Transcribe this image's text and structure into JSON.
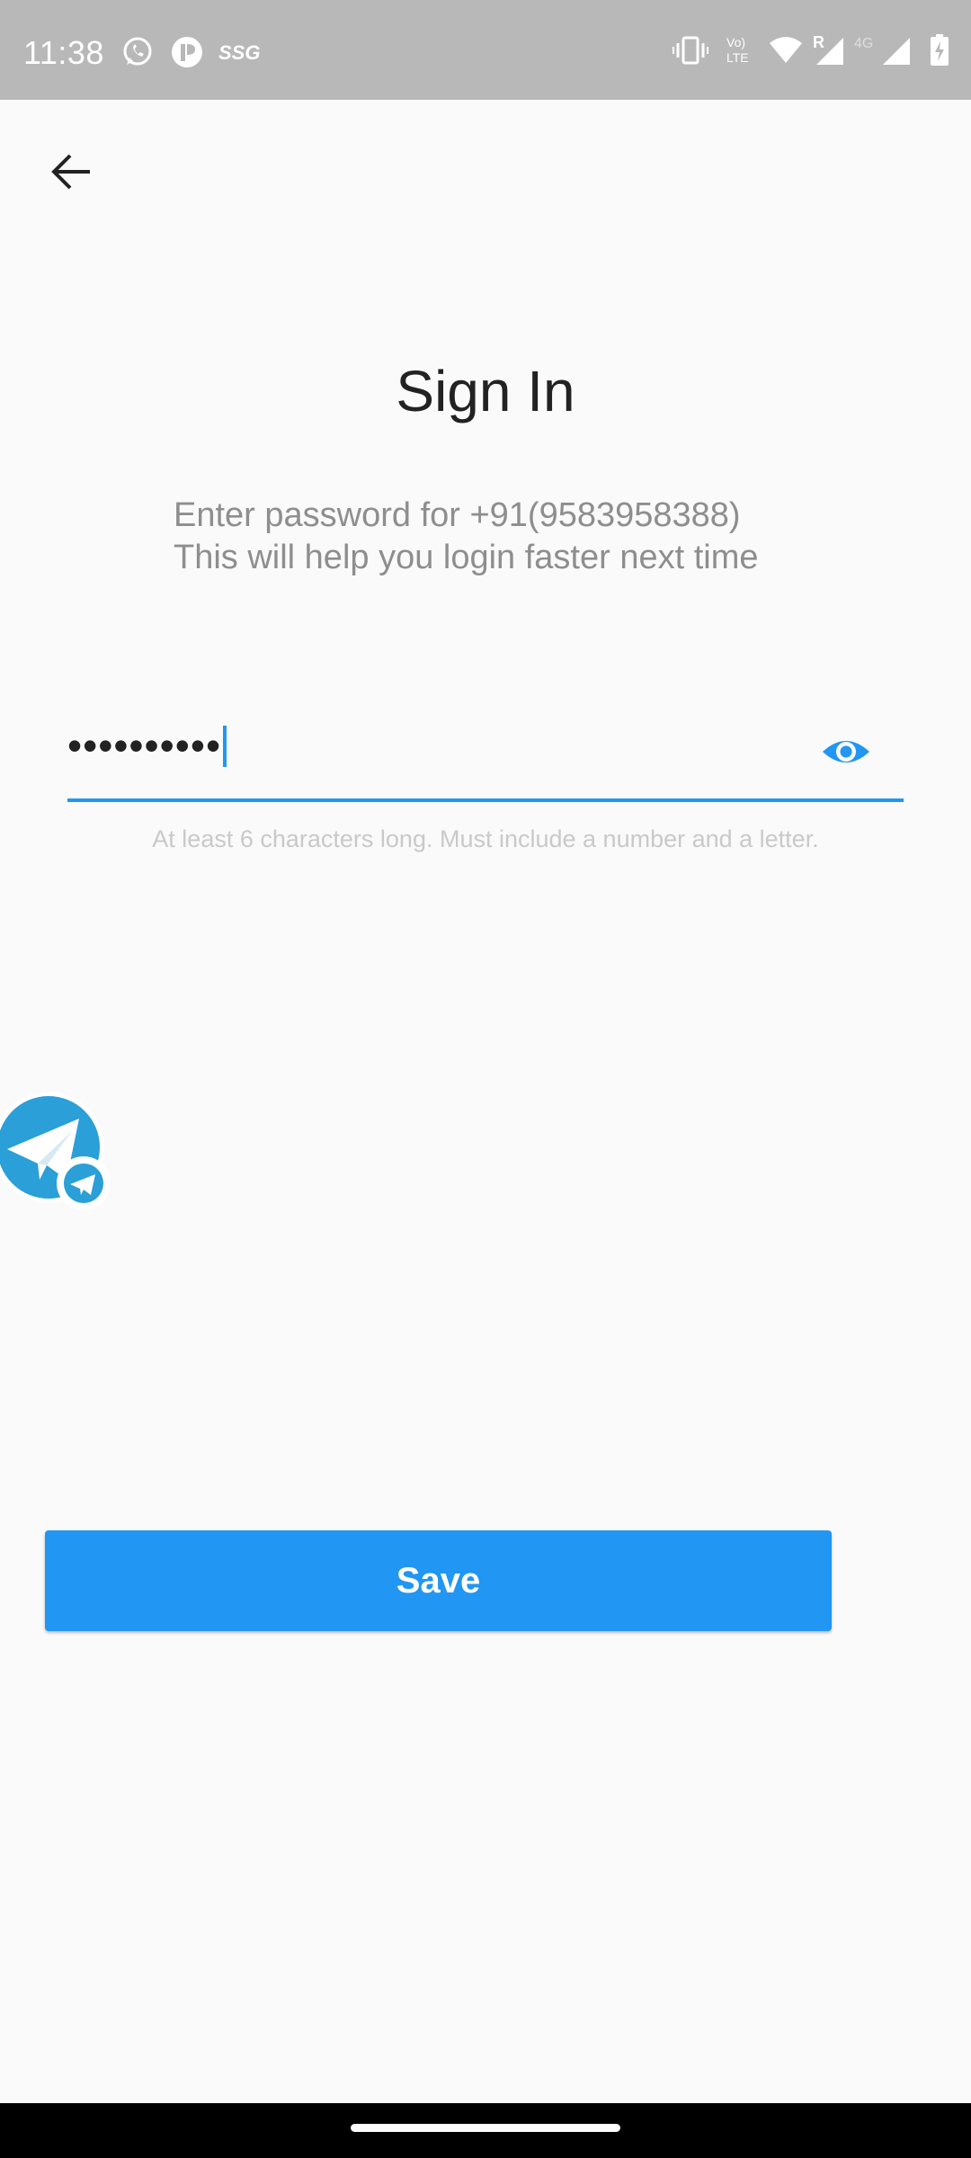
{
  "status_bar": {
    "time": "11:38",
    "icons_left": [
      "whatsapp-icon",
      "app-icon",
      "ssg-icon"
    ],
    "ssg_text": "SSG",
    "icons_right": [
      "vibrate-icon",
      "volte-icon",
      "wifi-icon",
      "signal-roaming-icon",
      "signal-4g-icon",
      "battery-charging-icon"
    ],
    "volte_text_top": "Vo)",
    "volte_text_bottom": "LTE",
    "roaming_text": "R",
    "network_text": "4G"
  },
  "header": {
    "back_icon": "arrow-left-icon"
  },
  "title": "Sign In",
  "subtitle": {
    "line1": "Enter password for +91(9583958388)",
    "line2": "This will help you login faster next time"
  },
  "password": {
    "masked_value": "••••••••••",
    "visibility_icon": "eye-icon"
  },
  "helper_text": "At least 6 characters long. Must include a number and a letter.",
  "floating_bubble_icon": "telegram-icon",
  "save_button": {
    "label": "Save"
  },
  "colors": {
    "accent": "#2196f3",
    "background": "#fafafa",
    "status_bar": "#b8b8b8"
  }
}
